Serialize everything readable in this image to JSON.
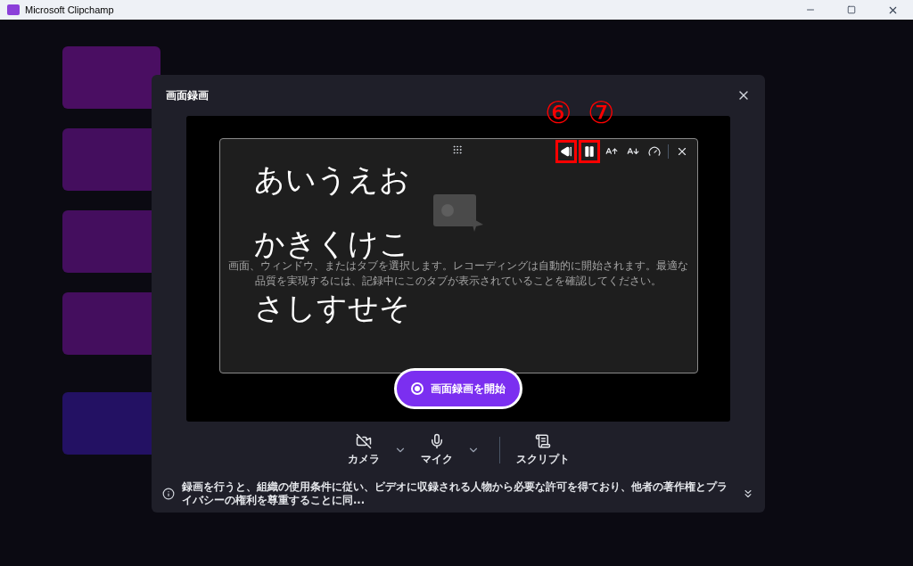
{
  "window": {
    "title": "Microsoft Clipchamp"
  },
  "dialog": {
    "title": "画面録画",
    "hint": "画面、ウィンドウ、またはタブを選択します。レコーディングは自動的に開始されます。最適な品質を実現するには、記録中にこのタブが表示されていることを確認してください。",
    "teleprompter": {
      "lines": [
        "あいうえお",
        "かきくけこ",
        "さしすせそ"
      ]
    },
    "start_button": "画面録画を開始",
    "controls": [
      {
        "kind": "camera",
        "label": "カメラ",
        "dropdown": true
      },
      {
        "kind": "mic",
        "label": "マイク",
        "dropdown": true
      },
      {
        "kind": "script",
        "label": "スクリプト",
        "dropdown": false
      }
    ],
    "notice": "録画を行うと、組織の使用条件に従い、ビデオに収録される人物から必要な許可を得ており、他者の著作権とプライバシーの権利を尊重することに同..."
  },
  "annotations": [
    {
      "label": "⑥"
    },
    {
      "label": "⑦"
    }
  ]
}
